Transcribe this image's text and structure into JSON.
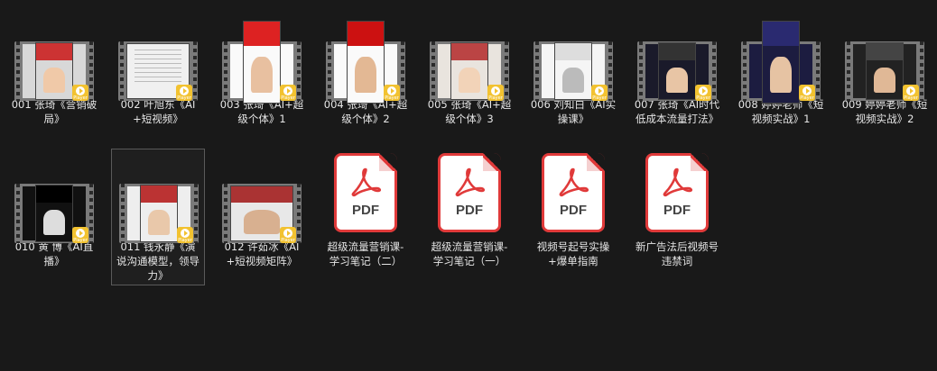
{
  "colors": {
    "background": "#191919",
    "text": "#e6e6e6",
    "player_badge": "#f2c230",
    "pdf_accent": "#e03a3a",
    "selection_border": "#5a5a5a"
  },
  "badge_text": "Player",
  "pdf_text": "PDF",
  "items": [
    {
      "name": "001 张琦《营销破局》",
      "type": "video",
      "thumb": "portrait"
    },
    {
      "name": "002 叶旭东《AI+短视频》",
      "type": "video",
      "thumb": "landscape"
    },
    {
      "name": "003 张琦《AI+超级个体》1",
      "type": "video",
      "thumb": "tall"
    },
    {
      "name": "004 张琦《AI+超级个体》2",
      "type": "video",
      "thumb": "tall"
    },
    {
      "name": "005 张琦《AI+超级个体》3",
      "type": "video",
      "thumb": "portrait"
    },
    {
      "name": "006 刘知白《AI实操课》",
      "type": "video",
      "thumb": "portrait"
    },
    {
      "name": "007 张琦《AI时代低成本流量打法》",
      "type": "video",
      "thumb": "portrait"
    },
    {
      "name": "008 婷婷老师《短视频实战》1",
      "type": "video",
      "thumb": "tall"
    },
    {
      "name": "009 婷婷老师《短视频实战》2",
      "type": "video",
      "thumb": "portrait"
    },
    {
      "name": "010 黄 博《AI直播》",
      "type": "video",
      "thumb": "portrait"
    },
    {
      "name": "011 钱永静《演说沟通模型，领导力》",
      "type": "video",
      "thumb": "portrait",
      "selected": true
    },
    {
      "name": "012 许茹冰《AI+短视频矩阵》",
      "type": "video",
      "thumb": "landscape"
    },
    {
      "name": "超级流量营销课-学习笔记（二）",
      "type": "pdf"
    },
    {
      "name": "超级流量营销课-学习笔记（一）",
      "type": "pdf"
    },
    {
      "name": "视频号起号实操+爆单指南",
      "type": "pdf"
    },
    {
      "name": "新广告法后视频号违禁词",
      "type": "pdf"
    }
  ]
}
